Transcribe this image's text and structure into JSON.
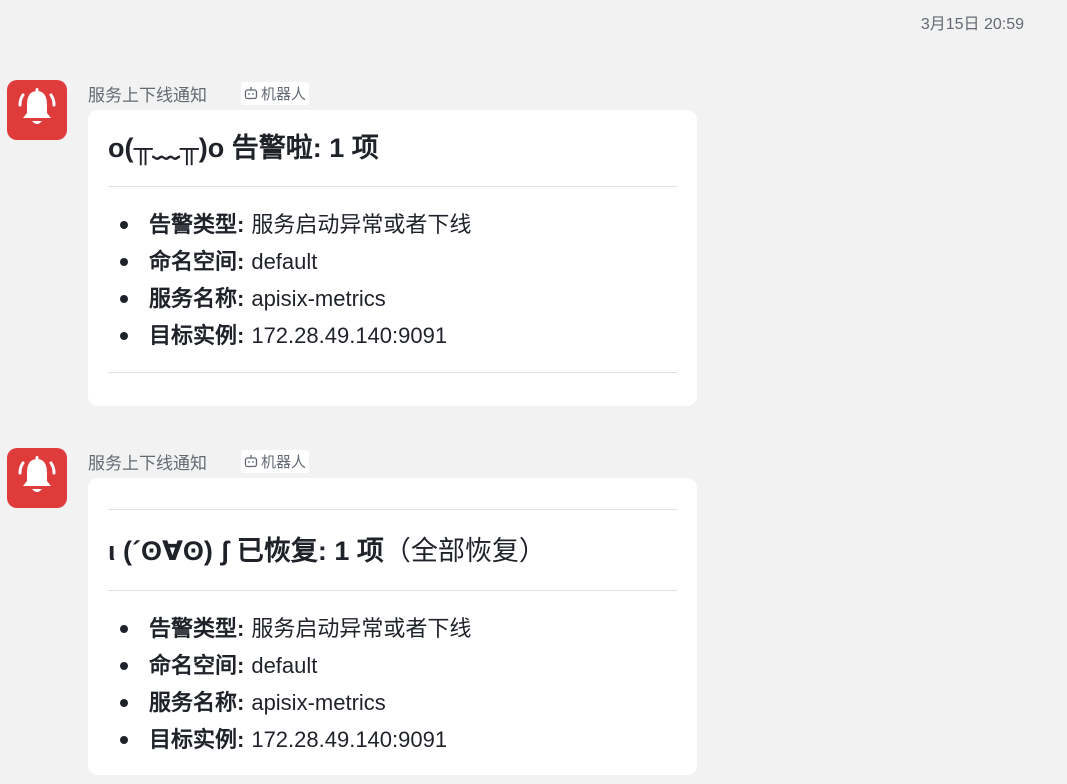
{
  "timestamp": "3月15日 20:59",
  "colors": {
    "avatar_bg": "#e03b3b",
    "page_bg": "#f2f2f3",
    "card_bg": "#ffffff"
  },
  "messages": [
    {
      "sender": "服务上下线通知",
      "bot_label": "机器人",
      "avatar_icon": "bell-icon",
      "title": "o(╥﹏╥)o 告警啦: 1 项",
      "title_suffix": "",
      "fields": [
        {
          "key": "告警类型:",
          "value": "服务启动异常或者下线"
        },
        {
          "key": "命名空间:",
          "value": "default"
        },
        {
          "key": "服务名称:",
          "value": "apisix-metrics"
        },
        {
          "key": "目标实例:",
          "value": "172.28.49.140:9091"
        }
      ]
    },
    {
      "sender": "服务上下线通知",
      "bot_label": "机器人",
      "avatar_icon": "bell-icon",
      "title": "ι (´ʘ∀ʘ) ʃ 已恢复: 1 项",
      "title_suffix": "（全部恢复）",
      "fields": [
        {
          "key": "告警类型:",
          "value": "服务启动异常或者下线"
        },
        {
          "key": "命名空间:",
          "value": "default"
        },
        {
          "key": "服务名称:",
          "value": "apisix-metrics"
        },
        {
          "key": "目标实例:",
          "value": "172.28.49.140:9091"
        }
      ]
    }
  ]
}
